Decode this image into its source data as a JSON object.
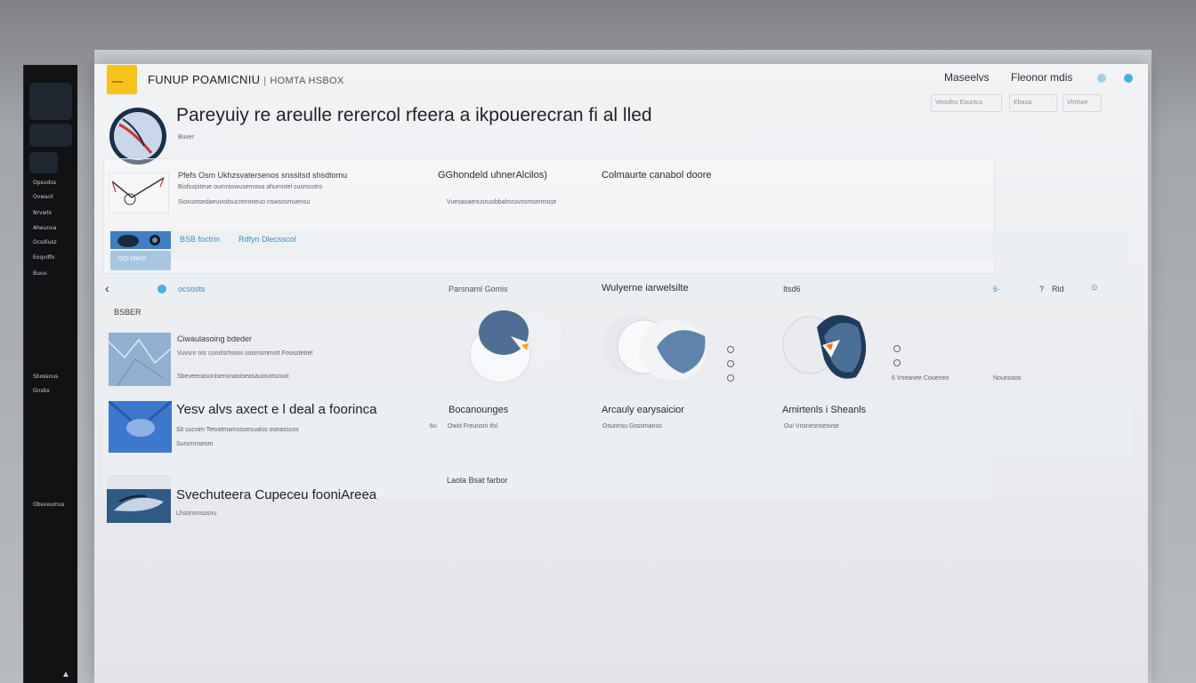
{
  "sidebar": {
    "items": [
      "Opsudos",
      "Ovwavt",
      "Nrvwts",
      "Aheunva",
      "Ocsdiusz",
      "Eoqvdfo",
      "Buuu",
      "Sbossnus",
      "Gnsbx",
      "Obsveumus"
    ]
  },
  "header": {
    "title": "FUNUP POAMICNIU",
    "separator": "|",
    "subtitle": "HOMTA HSBOX",
    "links": [
      "Maseelvs",
      "Fleonor mdis"
    ],
    "mini_buttons": [
      "Veoufeu Eauntus",
      "Ebaua",
      "Vhrtiwe"
    ],
    "dot_colors": [
      "#9fd0e6",
      "#48b2da"
    ]
  },
  "hero": {
    "heading": "Pareyuiy re areulle rerercol rfeera a ikpouerecran fi al lled",
    "sub": "Buver"
  },
  "row1": {
    "col1_title": "Pfefs Osm Ukhzsvatersenos snssitsd shsdtomu",
    "col1_line2": "Bisfozpiteue oumraswusemooa ahumntel susmcotro",
    "col1_line3": "Sioxuotsedaeuvodsucrenoneuo nswsosmuensu",
    "col2_title": "GGhondeld uhnerAlcilos)",
    "col2_line": "Vuesaoaenusnusbbahsssvssmsmmsrpt",
    "col3_title": "Colmaurte canabol doore"
  },
  "row2": {
    "link1": "BSB foctrin",
    "link2": "Rdfyn Dlecsscol",
    "thumb_label": "OGI MtHS"
  },
  "section": {
    "back": "‹",
    "tab": "ocsosts",
    "col_a": "Parsnaml Gomis",
    "col_b": "Wulyerne iarwelsilte",
    "col_c": "Itsd6",
    "controls": [
      "6·",
      "?",
      "Rld",
      "⊙"
    ],
    "label": "BSBER"
  },
  "card1": {
    "title": "Ciwaulasoing bdeder",
    "line2": "Vuvsnr osr conslsrhsoni sosmsmmsrt Foosstetrel",
    "line3": "Sbeveenasonlsenvnaoiseasauosotsouot",
    "side_a": "6 Vneanee Coueneo",
    "side_b": "Nouriosos"
  },
  "card2": {
    "title": "Yesv alvs axect e l deal a foorinca",
    "line2": "Sit sucsim Tetvatmamssseoualss oseasscos",
    "line3": "Sursrnnseom",
    "col_a": "Bocanounges",
    "col_a_pre": "6u",
    "col_a_sub": "Owid Freunsni Ifsl",
    "col_b": "Arcauly earysaicior",
    "col_b_sub": "Osunnsu Gsssmanus",
    "col_c": "Amirtenls i Sheanls",
    "col_c_sub": "Oui Vnsnesnsesvse"
  },
  "card3": {
    "title": "Svechuteera Cupeceu fooniAreea",
    "sub": "Lhsonsnsusnu",
    "mid": "Laola Bsat farbor"
  }
}
